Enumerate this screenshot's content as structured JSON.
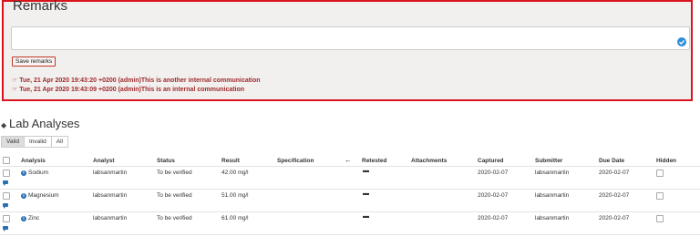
{
  "remarks": {
    "toggle_glyph": "◭",
    "title": "Remarks",
    "save_label": "Save remarks",
    "entries": [
      "☞ Tue, 21 Apr 2020 19:43:20 +0200 (admin)This is another internal communication",
      "☞ Tue, 21 Apr 2020 19:43:09 +0200 (admin)This is an internal communication"
    ],
    "border_color": "#d9141c"
  },
  "analyses": {
    "toggle_glyph": "◆",
    "title": "Lab Analyses",
    "filters": [
      "Valid",
      "Invalid",
      "All"
    ],
    "active_filter": "Valid",
    "columns": {
      "analysis": "Analysis",
      "analyst": "Analyst",
      "status": "Status",
      "result": "Result",
      "specification": "Specification",
      "retested": "Retested",
      "attachments": "Attachments",
      "captured": "Captured",
      "submitter": "Submitter",
      "due_date": "Due Date",
      "hidden": "Hidden"
    },
    "rows": [
      {
        "analysis": "Sodium",
        "analyst": "labsanmartin",
        "status": "To be verified",
        "result": "42.00",
        "unit": "mg/l",
        "retested": "▬",
        "captured": "2020-02-07",
        "submitter": "labsanmartin",
        "due_date": "2020-02-07"
      },
      {
        "analysis": "Magnesium",
        "analyst": "labsanmartin",
        "status": "To be verified",
        "result": "51.00",
        "unit": "mg/l",
        "retested": "▬",
        "captured": "2020-02-07",
        "submitter": "labsanmartin",
        "due_date": "2020-02-07"
      },
      {
        "analysis": "Zinc",
        "analyst": "labsanmartin",
        "status": "To be verified",
        "result": "61.00",
        "unit": "mg/l",
        "retested": "▬",
        "captured": "2020-02-07",
        "submitter": "labsanmartin",
        "due_date": "2020-02-07"
      }
    ]
  }
}
